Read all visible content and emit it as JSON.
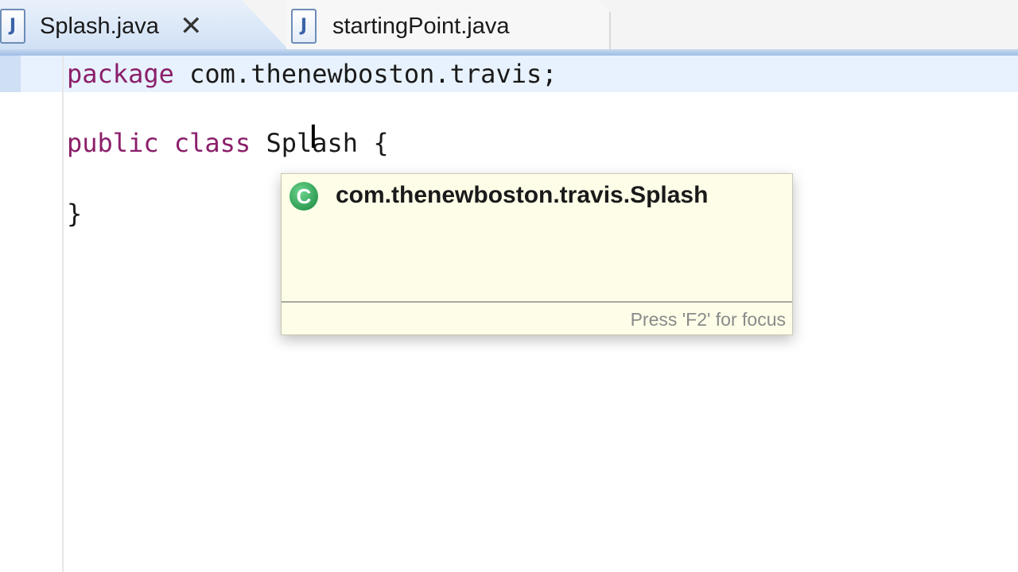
{
  "tabs": [
    {
      "label": "Splash.java",
      "icon": "java-file-icon",
      "active": true,
      "close_glyph": "✕"
    },
    {
      "label": "startingPoint.java",
      "icon": "java-file-icon",
      "active": false
    }
  ],
  "file_icon_glyph": "J",
  "editor": {
    "lines": [
      {
        "keyword": "package",
        "rest": " com.thenewboston.travis;"
      },
      {
        "keyword": "public class",
        "rest": " Splash {"
      },
      {
        "keyword": "",
        "rest": "}"
      }
    ],
    "colors": {
      "keyword": "#8b1f6a",
      "current_line": "#e8f2fe"
    }
  },
  "popup": {
    "icon": "class-icon",
    "icon_letter": "C",
    "title": "com.thenewboston.travis.Splash",
    "footer": "Press 'F2' for focus"
  }
}
